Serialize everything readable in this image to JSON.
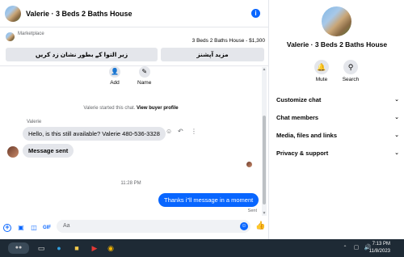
{
  "header": {
    "title": "Valerie · 3 Beds 2 Baths House",
    "info_icon": "info-icon"
  },
  "marketplace": {
    "label": "Marketplace",
    "listing": "3 Beds 2 Baths House - $1,300",
    "button_left": "زیر التوا کے بطور نشان زد کریں",
    "button_right": "مزید آپشنز"
  },
  "quick_actions": [
    {
      "label": "Add",
      "icon": "add-person-icon"
    },
    {
      "label": "Name",
      "icon": "pencil-icon"
    }
  ],
  "system_message": {
    "text": "Valerie started this chat.",
    "link": "View buyer profile"
  },
  "messages": {
    "sender_name": "Valerie",
    "incoming_1": "Hello, is this still available? Valerie 480-536-3328",
    "incoming_2": "Message sent",
    "timestamp": "11:28 PM",
    "outgoing_1": "Thanks i\"ll message in a moment",
    "status": "Sent"
  },
  "composer": {
    "placeholder": "Aa"
  },
  "right_panel": {
    "title": "Valerie · 3 Beds 2 Baths House",
    "actions": [
      {
        "label": "Mute",
        "icon": "bell-icon"
      },
      {
        "label": "Search",
        "icon": "search-icon"
      }
    ],
    "sections": [
      "Customize chat",
      "Chat members",
      "Media, files and links",
      "Privacy & support"
    ]
  },
  "taskbar": {
    "time": "7:13 PM",
    "date": "11/8/2023"
  },
  "colors": {
    "accent": "#0866ff",
    "bubble_in": "#e4e6eb",
    "taskbar": "#1e2a35"
  }
}
